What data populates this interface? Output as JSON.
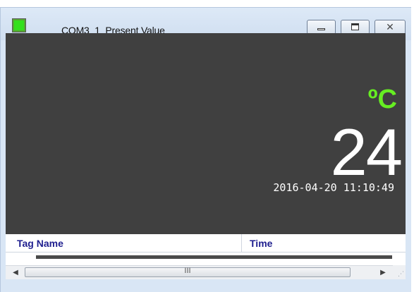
{
  "window": {
    "title": "COM3_1_Present Value",
    "minimize_glyph": "",
    "maximize_glyph": "",
    "close_glyph": "✕"
  },
  "display": {
    "unit": "ºC",
    "value": "24",
    "timestamp": "2016-04-20 11:10:49"
  },
  "table": {
    "columns": [
      "Tag Name",
      "Time"
    ]
  },
  "scrollbar": {
    "left_arrow": "◀",
    "right_arrow": "▶",
    "grip": "III"
  },
  "colors": {
    "display_bg": "#404040",
    "unit_color": "#66ee22",
    "value_color": "#ffffff",
    "header_text": "#1f1f8f",
    "icon_green": "#33e01d"
  },
  "icons": {
    "app": "green-square-icon",
    "minimize": "minimize-icon",
    "maximize": "maximize-icon",
    "close": "close-icon",
    "resize": "resize-grip-icon"
  }
}
